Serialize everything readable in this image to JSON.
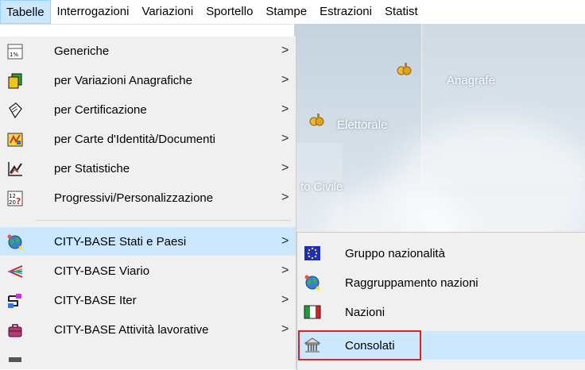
{
  "menubar": {
    "items": [
      "Tabelle",
      "Interrogazioni",
      "Variazioni",
      "Sportello",
      "Stampe",
      "Estrazioni",
      "Statist"
    ]
  },
  "background": {
    "labels": [
      "Anagrafe",
      "Elettorale",
      "to Civile"
    ]
  },
  "menu": {
    "items": [
      {
        "label": "Generiche",
        "icon": "table-icon"
      },
      {
        "label": "per Variazioni Anagrafiche",
        "icon": "documents-icon"
      },
      {
        "label": "per Certificazione",
        "icon": "certificate-icon"
      },
      {
        "label": "per Carte d'Identità/Documenti",
        "icon": "id-card-icon"
      },
      {
        "label": "per Statistiche",
        "icon": "chart-icon"
      },
      {
        "label": "Progressivi/Personalizzazione",
        "icon": "counter-icon"
      },
      {
        "label": "CITY-BASE Stati e Paesi",
        "icon": "globe-icon"
      },
      {
        "label": "CITY-BASE Viario",
        "icon": "streets-icon"
      },
      {
        "label": "CITY-BASE Iter",
        "icon": "workflow-icon"
      },
      {
        "label": "CITY-BASE Attività lavorative",
        "icon": "briefcase-icon"
      }
    ],
    "arrow": ">"
  },
  "submenu": {
    "items": [
      {
        "label": "Gruppo nazionalità",
        "icon": "eu-flag-icon"
      },
      {
        "label": "Raggruppamento nazioni",
        "icon": "globe-icon"
      },
      {
        "label": "Nazioni",
        "icon": "italy-flag-icon"
      },
      {
        "label": "Consolati",
        "icon": "consulate-building-icon"
      }
    ]
  },
  "colors": {
    "highlight": "#cce8ff",
    "callout": "#e01f1f"
  }
}
